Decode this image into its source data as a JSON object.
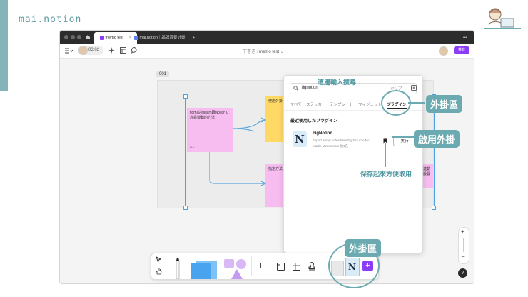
{
  "brand": "mai.notion",
  "tabs": {
    "active": "memo test",
    "second": "mai.notion｜品牌背景計畫",
    "add": "+",
    "more": "•••"
  },
  "toolbar": {
    "time": "03:02",
    "breadcrumb_parent": "下書き",
    "breadcrumb_sep": "/",
    "file_name": "memo test",
    "share_label": "共有"
  },
  "canvas": {
    "section_label": "001",
    "stickies": [
      {
        "text": "figma的figjam跟Notion０\n片員連動的方法",
        "foot": "Mai"
      },
      {
        "text": "使用外掛",
        "foot": ""
      },
      {
        "text": "指定方法",
        "foot": ""
      },
      {
        "text": "",
        "foot": ""
      }
    ],
    "partial_right_text": "連動\n設置"
  },
  "plugin_panel": {
    "search_value": "fignotion",
    "clear_label": "クリア",
    "tabs": [
      "すべて",
      "ステッカー",
      "テンプレート",
      "ウィジェット",
      "プラグイン"
    ],
    "section_title": "最近使用したプラグイン",
    "plugin": {
      "name": "FigNotion",
      "description": "Export sticky notes from FigJam into No...",
      "author": "Martin Menschrom 他1名",
      "run_label": "実行"
    }
  },
  "annotations": {
    "search_hint": "這邊輸入搜尋",
    "plugin_area": "外掛區",
    "enable_plugin": "啟用外掛",
    "save_hint": "保存起來方便取用",
    "plugin_area_bottom": "外掛區"
  },
  "help_label": "?",
  "colors": {
    "accent": "#6aaab0",
    "share": "#8b3cf7",
    "sticky_pink": "#f7bdf0",
    "sticky_yellow": "#ffd966",
    "selection": "#4ba3e3"
  }
}
